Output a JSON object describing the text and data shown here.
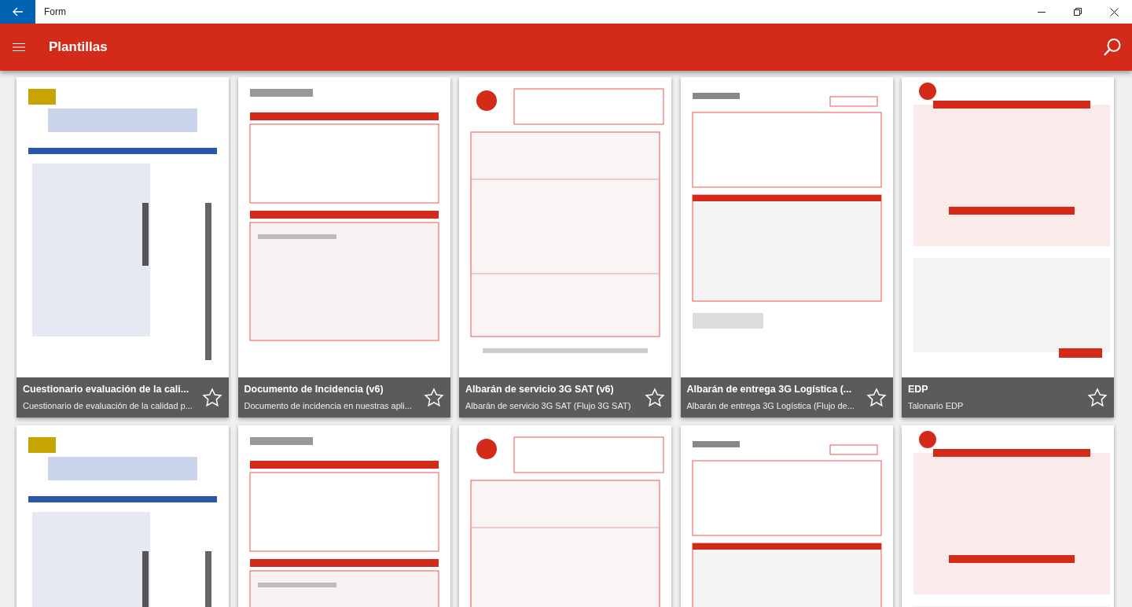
{
  "window": {
    "title": "Form"
  },
  "app_bar": {
    "title": "Plantillas"
  },
  "templates": [
    {
      "kind": "card",
      "title": "Cuestionario evaluación de la cali...",
      "subtitle": "Cuestionario de evaluación de la calidad p...",
      "starred": false
    },
    {
      "kind": "card",
      "title": "Documento de Incidencia (v6)",
      "subtitle": "Documento de incidencia en nuestras apli...",
      "starred": false
    },
    {
      "kind": "card",
      "title": "Albarán de servicio 3G SAT (v6)",
      "subtitle": "Albarán de servicio 3G SAT (Flujo 3G SAT)",
      "starred": false
    },
    {
      "kind": "card",
      "title": "Albarán de entrega 3G Logística (...",
      "subtitle": "Albarán de entrega 3G Logística (Flujo de...",
      "starred": false
    },
    {
      "kind": "card",
      "title": "EDP",
      "subtitle": "Talonario EDP",
      "starred": false
    },
    {
      "kind": "picture"
    },
    {
      "kind": "picture"
    },
    {
      "kind": "picture"
    },
    {
      "kind": "picture"
    },
    {
      "kind": "picture"
    }
  ]
}
